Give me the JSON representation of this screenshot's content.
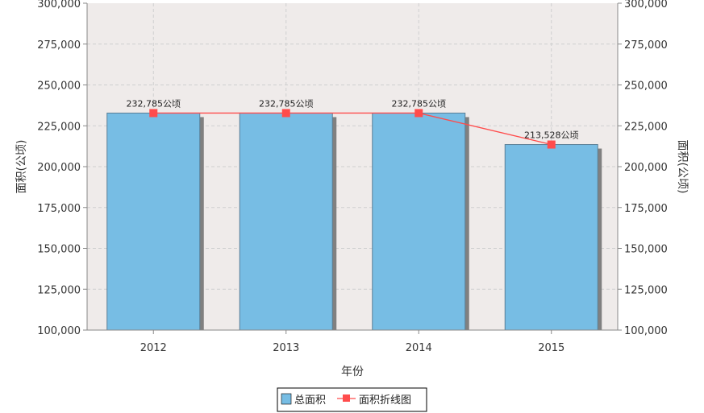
{
  "chart_data": {
    "type": "bar",
    "categories": [
      "2012",
      "2013",
      "2014",
      "2015"
    ],
    "series": [
      {
        "name": "总面积",
        "type": "bar",
        "values": [
          232785,
          232785,
          232785,
          213528
        ],
        "color": "#77bde4"
      },
      {
        "name": "面积折线图",
        "type": "line",
        "values": [
          232785,
          232785,
          232785,
          213528
        ],
        "color": "#ff4c4c"
      }
    ],
    "data_labels": [
      "232,785公顷",
      "232,785公顷",
      "232,785公顷",
      "213,528公顷"
    ],
    "xlabel": "年份",
    "ylabel_left": "面积(公顷)",
    "ylabel_right": "面积(公顷)",
    "ylim": [
      100000,
      300000
    ],
    "yticks": [
      "100,000",
      "125,000",
      "150,000",
      "175,000",
      "200,000",
      "225,000",
      "250,000",
      "275,000",
      "300,000"
    ],
    "ytick_values": [
      100000,
      125000,
      150000,
      175000,
      200000,
      225000,
      250000,
      275000,
      300000
    ],
    "grid": true,
    "legend_position": "bottom-center",
    "colors": {
      "plot_background": "#efebea",
      "grid": "#cfcfcf",
      "bar_shadow": "#808080",
      "bar_border": "#5a7f96"
    }
  }
}
